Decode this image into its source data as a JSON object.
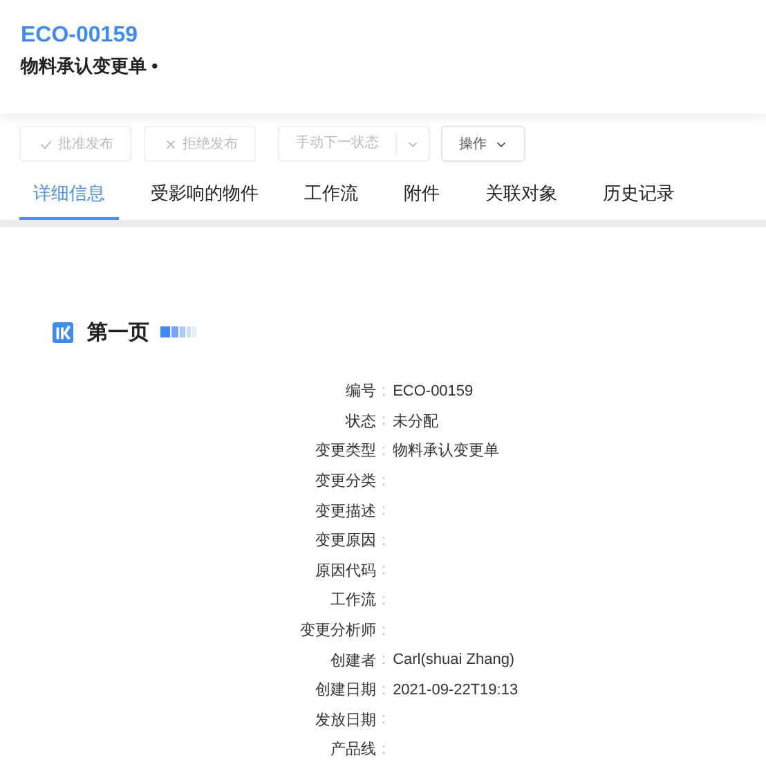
{
  "header": {
    "code": "ECO-00159",
    "subtitle": "物料承认变更单 •"
  },
  "toolbar": [
    {
      "kind": "approve",
      "label": "批准发布",
      "disabled": true
    },
    {
      "kind": "reject",
      "label": "拒绝发布",
      "disabled": true
    },
    {
      "kind": "split",
      "label": "手动下一状态",
      "disabled": true
    },
    {
      "kind": "menu",
      "label": "操作",
      "disabled": false
    }
  ],
  "tabs": [
    {
      "label": "详细信息",
      "selected": true
    },
    {
      "label": "受影响的物件",
      "selected": false
    },
    {
      "label": "工作流",
      "selected": false
    },
    {
      "label": "附件",
      "selected": false
    },
    {
      "label": "关联对象",
      "selected": false
    },
    {
      "label": "历史记录",
      "selected": false
    }
  ],
  "section": {
    "title": "第一页"
  },
  "fields": [
    {
      "label": "编号",
      "colon": ":",
      "value": "ECO-00159"
    },
    {
      "label": "状态",
      "colon": ":",
      "value": "未分配"
    },
    {
      "label": "变更类型",
      "colon": ":",
      "value": "物料承认变更单"
    },
    {
      "label": "变更分类",
      "colon": ":"
    },
    {
      "label": "变更描述",
      "colon": ":"
    },
    {
      "label": "变更原因",
      "colon": ":"
    },
    {
      "label": "原因代码",
      "colon": ":"
    },
    {
      "label": "工作流",
      "colon": ":"
    },
    {
      "label": "变更分析师",
      "colon": ":"
    },
    {
      "label": "创建者",
      "colon": ":",
      "value": "Carl(shuai Zhang)"
    },
    {
      "label": "创建日期",
      "colon": ":",
      "value": "2021-09-22T19:13"
    },
    {
      "label": "发放日期",
      "colon": ":"
    },
    {
      "label": "产品线",
      "colon": ":"
    }
  ]
}
